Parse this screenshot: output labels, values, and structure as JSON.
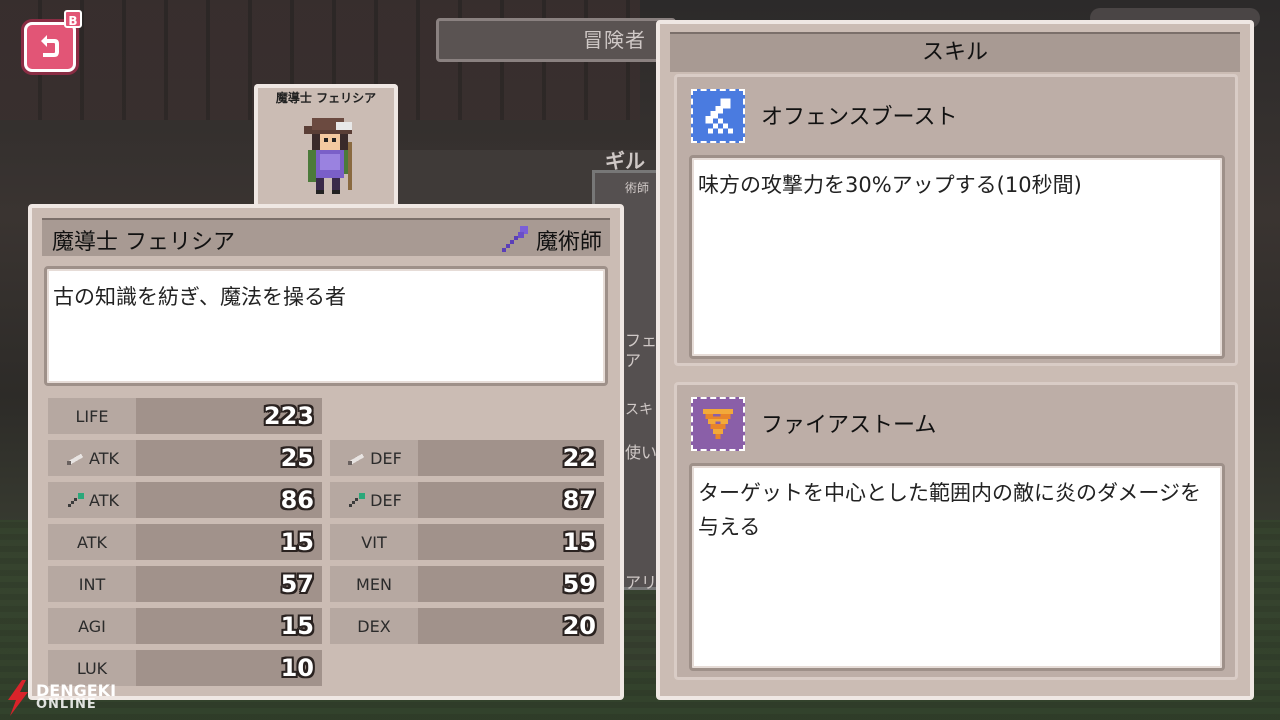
{
  "background": {
    "ribbon_text": "冒険者",
    "card_texts": [
      "術師",
      "フェ",
      "ア",
      "スキ",
      "使い",
      "アリ"
    ],
    "guild_text": "ギル"
  },
  "back_button": {
    "badge": "B"
  },
  "character": {
    "tab_name": "魔導士 フェリシア",
    "name": "魔導士 フェリシア",
    "job": "魔術師",
    "description": "古の知識を紡ぎ、魔法を操る者"
  },
  "stats": {
    "life": {
      "label": "LIFE",
      "value": "223"
    },
    "phys_atk": {
      "label": "ATK",
      "icon": "sword-icon",
      "value": "25"
    },
    "phys_def": {
      "label": "DEF",
      "icon": "sword-icon",
      "value": "22"
    },
    "mag_atk": {
      "label": "ATK",
      "icon": "staff-icon",
      "value": "86"
    },
    "mag_def": {
      "label": "DEF",
      "icon": "staff-icon",
      "value": "87"
    },
    "atk": {
      "label": "ATK",
      "value": "15"
    },
    "vit": {
      "label": "VIT",
      "value": "15"
    },
    "int": {
      "label": "INT",
      "value": "57"
    },
    "men": {
      "label": "MEN",
      "value": "59"
    },
    "agi": {
      "label": "AGI",
      "value": "15"
    },
    "dex": {
      "label": "DEX",
      "value": "20"
    },
    "luk": {
      "label": "LUK",
      "value": "10"
    }
  },
  "skills": {
    "header": "スキル",
    "items": [
      {
        "name": "オフェンスブースト",
        "icon": "offense-boost-icon",
        "icon_color": "#4a7be0",
        "description": "味方の攻撃力を30%アップする(10秒間)"
      },
      {
        "name": "ファイアストーム",
        "icon": "fire-storm-icon",
        "icon_color": "#8a5fa8",
        "description": "ターゲットを中心とした範囲内の敵に炎のダメージを与える"
      }
    ]
  },
  "watermark": {
    "line1": "DENGEKI",
    "line2": "ONLINE"
  }
}
